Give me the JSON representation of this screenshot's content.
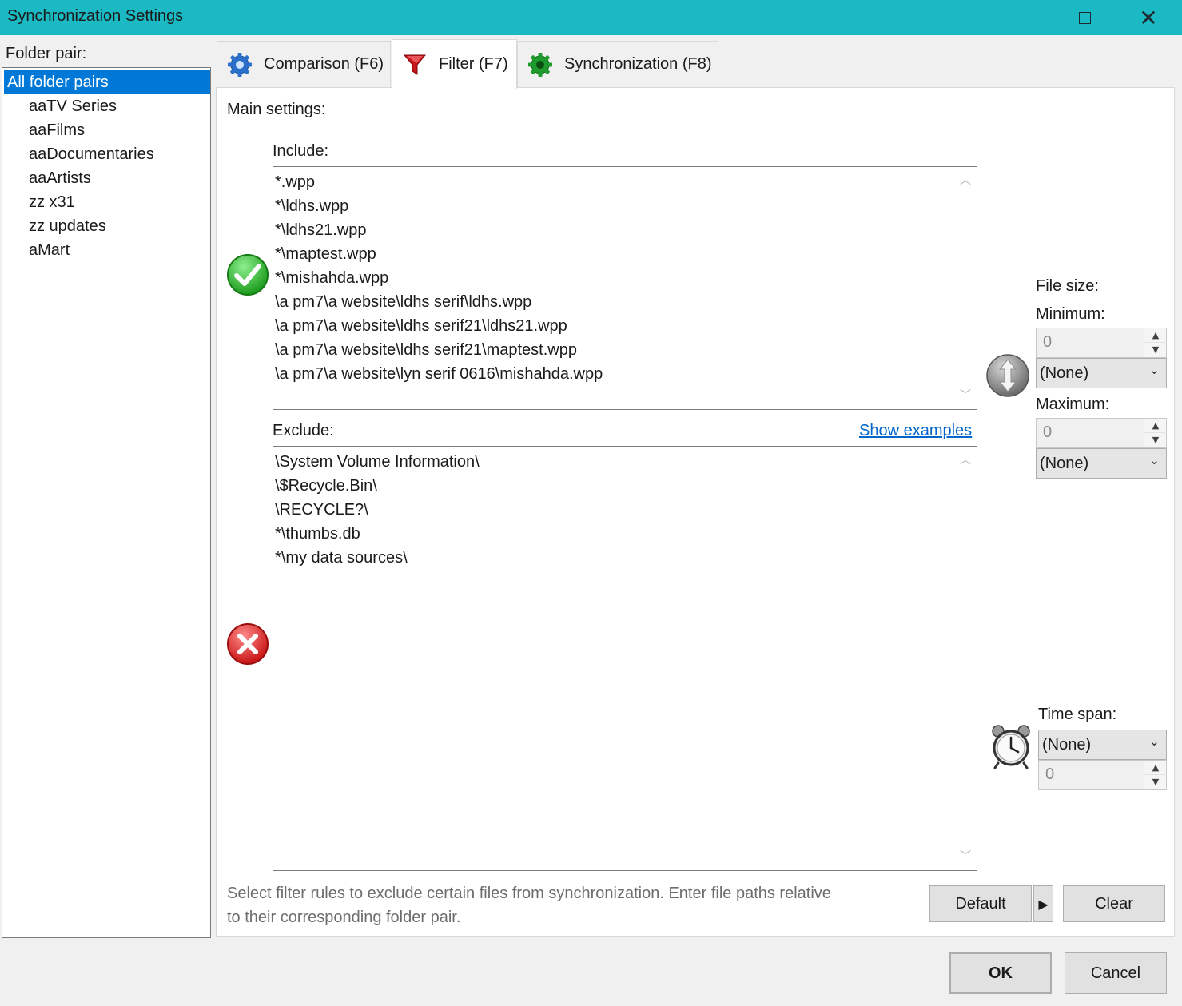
{
  "window": {
    "title": "Synchronization Settings"
  },
  "folder_pairs": {
    "label": "Folder pair:",
    "items": [
      "All folder pairs",
      "aaTV Series",
      "aaFilms",
      "aaDocumentaries",
      "aaArtists",
      "zz x31",
      "zz updates",
      "aMart"
    ]
  },
  "tabs": [
    {
      "label": "Comparison (F6)",
      "icon": "gear-blue-icon"
    },
    {
      "label": "Filter (F7)",
      "icon": "funnel-icon",
      "active": true
    },
    {
      "label": "Synchronization (F8)",
      "icon": "gear-green-icon"
    }
  ],
  "filter": {
    "main_settings": "Main settings:",
    "include_label": "Include:",
    "include": [
      "*.wpp",
      "*\\ldhs.wpp",
      "*\\ldhs21.wpp",
      "*\\maptest.wpp",
      "*\\mishahda.wpp",
      "\\a pm7\\a website\\ldhs serif\\ldhs.wpp",
      "\\a pm7\\a website\\ldhs serif21\\ldhs21.wpp",
      "\\a pm7\\a website\\ldhs serif21\\maptest.wpp",
      "\\a pm7\\a website\\lyn serif 0616\\mishahda.wpp"
    ],
    "exclude_label": "Exclude:",
    "show_examples": "Show examples",
    "exclude": [
      "\\System Volume Information\\",
      "\\$Recycle.Bin\\",
      "\\RECYCLE?\\",
      "*\\thumbs.db",
      "*\\my data sources\\"
    ],
    "description": "Select filter rules to exclude certain files from synchronization. Enter file paths relative to their corresponding folder pair."
  },
  "file_size": {
    "label": "File size:",
    "minimum_label": "Minimum:",
    "minimum_value": "0",
    "minimum_unit": "(None)",
    "maximum_label": "Maximum:",
    "maximum_value": "0",
    "maximum_unit": "(None)"
  },
  "time_span": {
    "label": "Time span:",
    "unit": "(None)",
    "value": "0"
  },
  "buttons": {
    "default": "Default",
    "clear": "Clear",
    "ok": "OK",
    "cancel": "Cancel"
  },
  "colors": {
    "titlebar": "#1bb9c4",
    "selection": "#0078d7",
    "link": "#0066cc"
  }
}
